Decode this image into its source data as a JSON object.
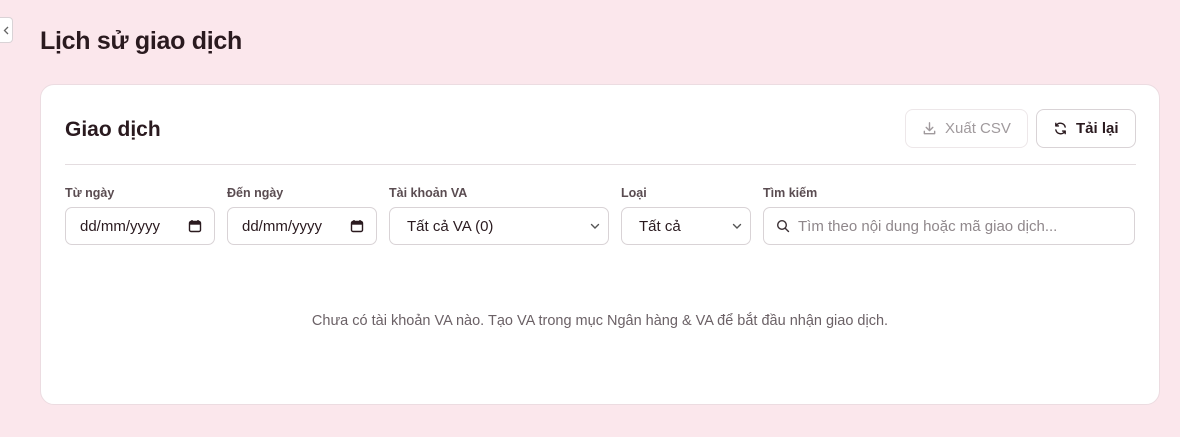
{
  "page": {
    "title": "Lịch sử giao dịch",
    "back_icon": "chevron-left-icon"
  },
  "card": {
    "title": "Giao dịch",
    "export_button": {
      "label": "Xuất CSV",
      "icon": "download-icon",
      "disabled": true
    },
    "reload_button": {
      "label": "Tải lại",
      "icon": "refresh-icon"
    }
  },
  "filters": {
    "from_date": {
      "label": "Từ ngày",
      "placeholder": "dd/mm/yyyy",
      "icon": "calendar-icon"
    },
    "to_date": {
      "label": "Đến ngày",
      "placeholder": "dd/mm/yyyy",
      "icon": "calendar-icon"
    },
    "va_account": {
      "label": "Tài khoản VA",
      "selected": "Tất cả VA (0)",
      "icon": "chevron-down-icon"
    },
    "type": {
      "label": "Loại",
      "selected": "Tất cả",
      "icon": "chevron-down-icon"
    },
    "search": {
      "label": "Tìm kiếm",
      "placeholder": "Tìm theo nội dung hoặc mã giao dịch...",
      "icon": "search-icon"
    }
  },
  "empty_state": {
    "message": "Chưa có tài khoản VA nào. Tạo VA trong mục Ngân hàng & VA để bắt đầu nhận giao dịch."
  },
  "colors": {
    "background": "#fbe7ec",
    "card": "#ffffff",
    "text": "#2a1a1f",
    "muted": "#6b6166"
  }
}
